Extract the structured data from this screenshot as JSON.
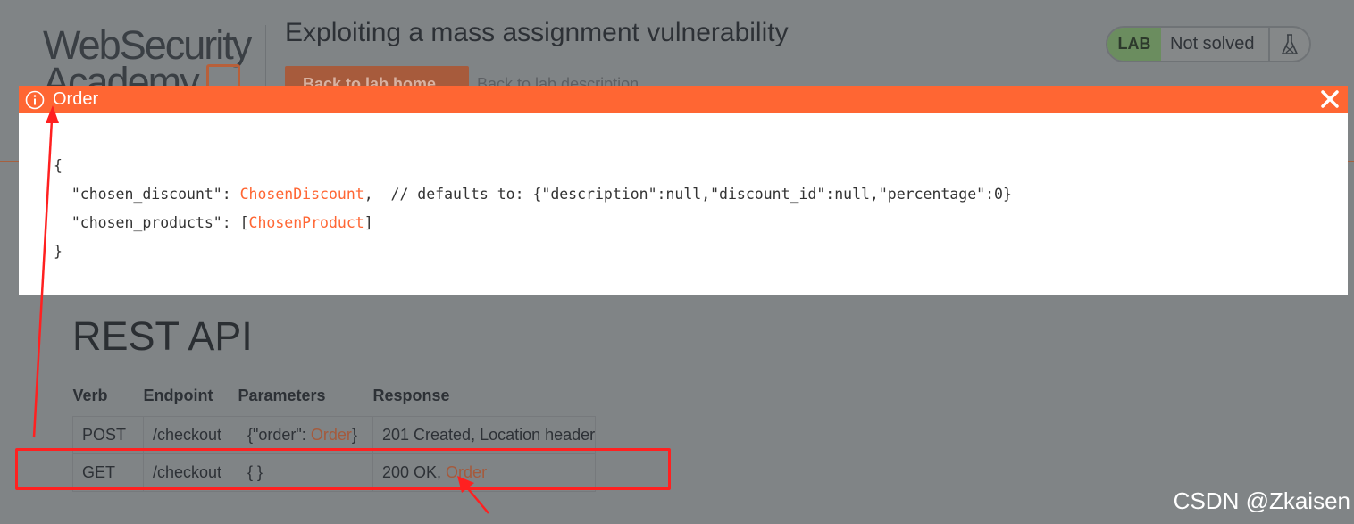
{
  "header": {
    "logo_line1": "WebSecurity",
    "logo_line2": "Academy",
    "lab_title": "Exploiting a mass assignment vulnerability",
    "back_button": "Back to lab home",
    "back_link": "Back to lab description",
    "status_badge": "LAB",
    "status_text": "Not solved",
    "status_icon": "flask-icon"
  },
  "modal": {
    "icon": "info-icon",
    "title": "Order",
    "close_icon": "close-icon",
    "code": {
      "open_brace": "{",
      "line1_key": "  \"chosen_discount\": ",
      "line1_type": "ChosenDiscount",
      "line1_comment": ",  // defaults to: {\"description\":null,\"discount_id\":null,\"percentage\":0}",
      "line2_key": "  \"chosen_products\": [",
      "line2_type": "ChosenProduct",
      "line2_end": "]",
      "close_brace": "}"
    }
  },
  "rest_api": {
    "title": "REST API",
    "columns": [
      "Verb",
      "Endpoint",
      "Parameters",
      "Response"
    ],
    "rows": [
      {
        "verb": "POST",
        "endpoint": "/checkout",
        "params_prefix": "{\"order\": ",
        "params_link": "Order",
        "params_suffix": "}",
        "response_text": "201 Created, Location header",
        "response_link": ""
      },
      {
        "verb": "GET",
        "endpoint": "/checkout",
        "params_prefix": "{ }",
        "params_link": "",
        "params_suffix": "",
        "response_text": "200 OK, ",
        "response_link": "Order"
      }
    ]
  },
  "watermark": "CSDN @Zkaisen",
  "colors": {
    "accent": "#ff6633",
    "annotation": "#ff2020",
    "overlay": "#808486"
  }
}
